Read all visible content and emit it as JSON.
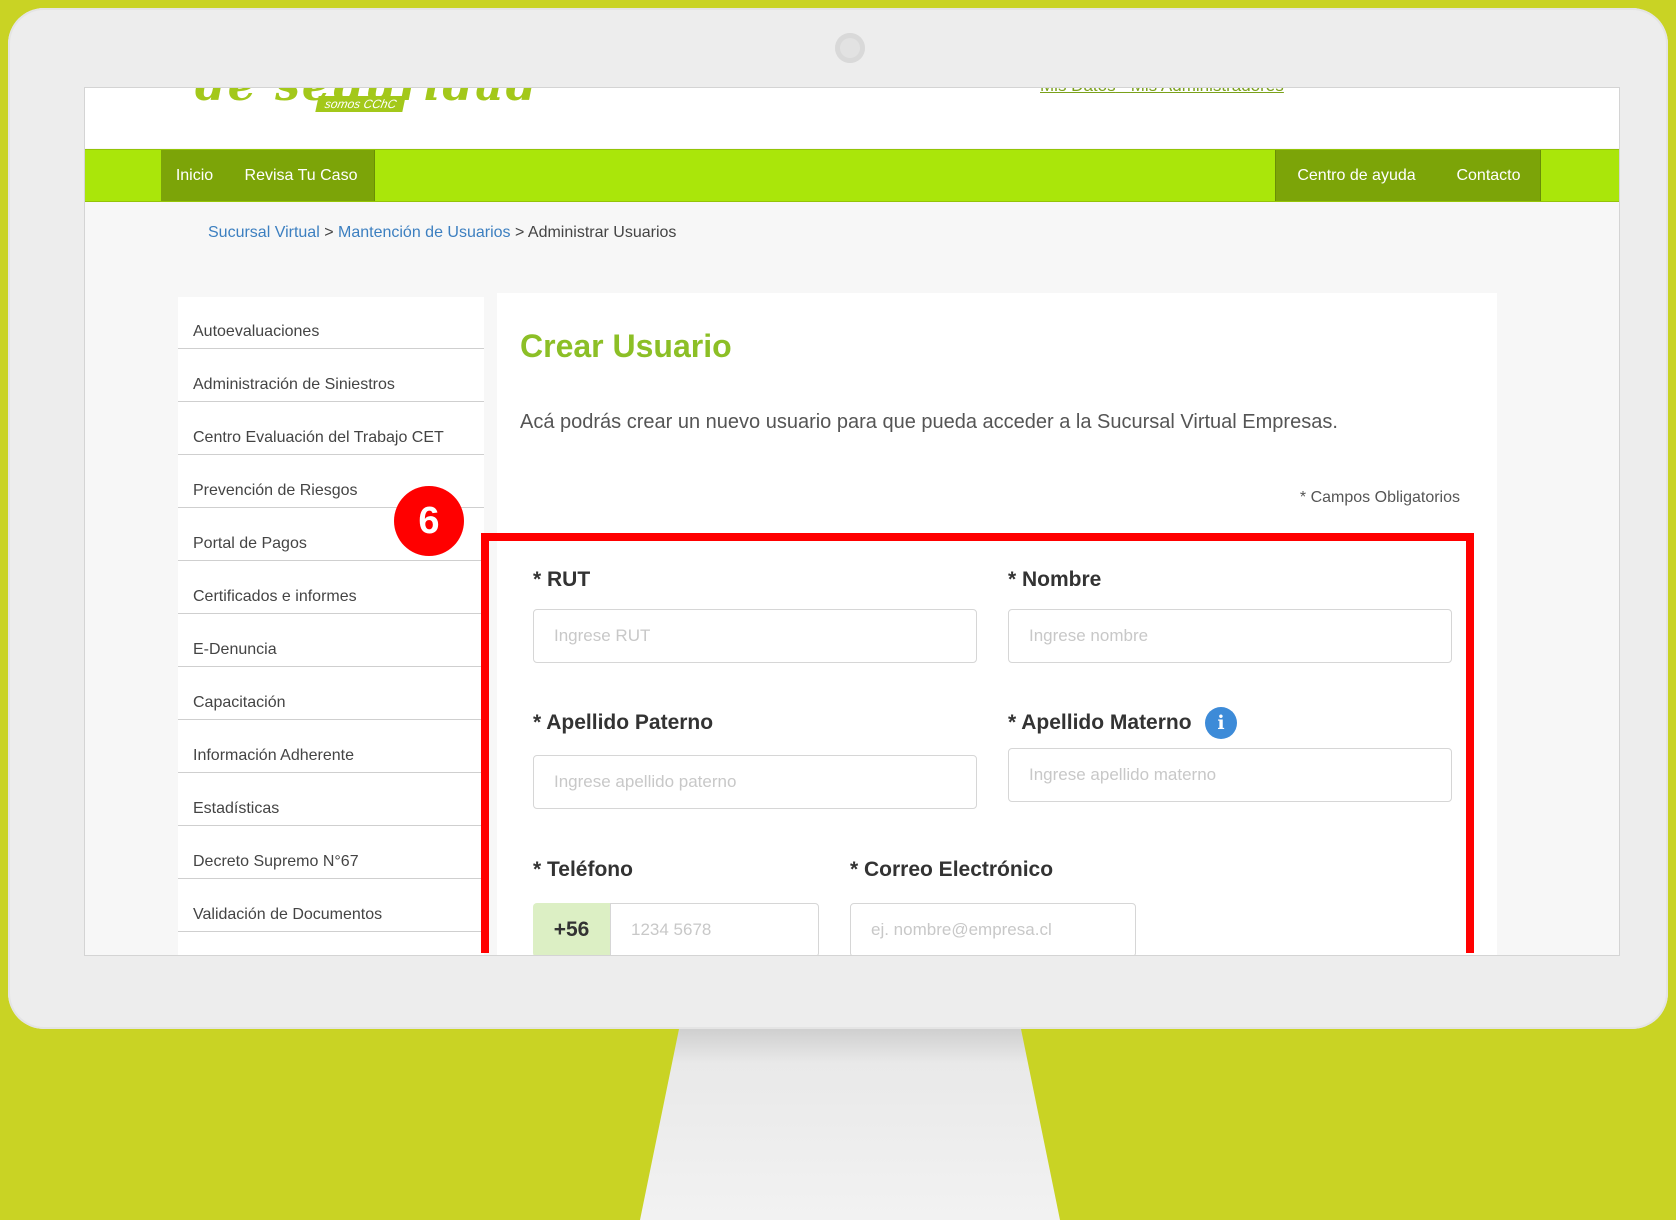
{
  "header": {
    "logo_text": "de seguridad",
    "logo_sub": "somos CChC",
    "link_mis_datos": "Mis Datos",
    "link_separator": " - ",
    "link_mis_admin": "Mis Administradores"
  },
  "nav": {
    "inicio": "Inicio",
    "revisa": "Revisa Tu Caso",
    "centro_ayuda": "Centro de ayuda",
    "contacto": "Contacto"
  },
  "breadcrumb": {
    "item1": "Sucursal Virtual",
    "sep": " > ",
    "item2": "Mantención de Usuarios",
    "item3": "Administrar Usuarios"
  },
  "sidebar": {
    "items": [
      {
        "label": "Autoevaluaciones"
      },
      {
        "label": "Administración de Siniestros"
      },
      {
        "label": "Centro Evaluación del Trabajo CET"
      },
      {
        "label": "Prevención de Riesgos"
      },
      {
        "label": "Portal de Pagos"
      },
      {
        "label": "Certificados e informes"
      },
      {
        "label": "E-Denuncia"
      },
      {
        "label": "Capacitación"
      },
      {
        "label": "Información Adherente"
      },
      {
        "label": "Estadísticas"
      },
      {
        "label": "Decreto Supremo N°67"
      },
      {
        "label": "Validación de Documentos"
      }
    ]
  },
  "form": {
    "title": "Crear Usuario",
    "description": "Acá podrás crear un nuevo usuario para que pueda acceder a la Sucursal Virtual Empresas.",
    "required_note": "* Campos Obligatorios",
    "rut_label": "* RUT",
    "rut_placeholder": "Ingrese RUT",
    "nombre_label": "* Nombre",
    "nombre_placeholder": "Ingrese nombre",
    "apellido_paterno_label": "* Apellido Paterno",
    "apellido_paterno_placeholder": "Ingrese apellido paterno",
    "apellido_materno_label": "* Apellido Materno",
    "apellido_materno_placeholder": "Ingrese apellido materno",
    "telefono_label": "* Teléfono",
    "telefono_prefix": "+56",
    "telefono_placeholder": "1234 5678",
    "correo_label": "* Correo Electrónico",
    "correo_placeholder": "ej. nombre@empresa.cl",
    "info_icon_glyph": "i"
  },
  "annotation": {
    "step_number": "6",
    "color": "#ff0000"
  },
  "colors": {
    "background": "#c9d324",
    "nav_green": "#aae60a",
    "nav_button": "#7ca408",
    "title_green": "#8cbf26"
  }
}
